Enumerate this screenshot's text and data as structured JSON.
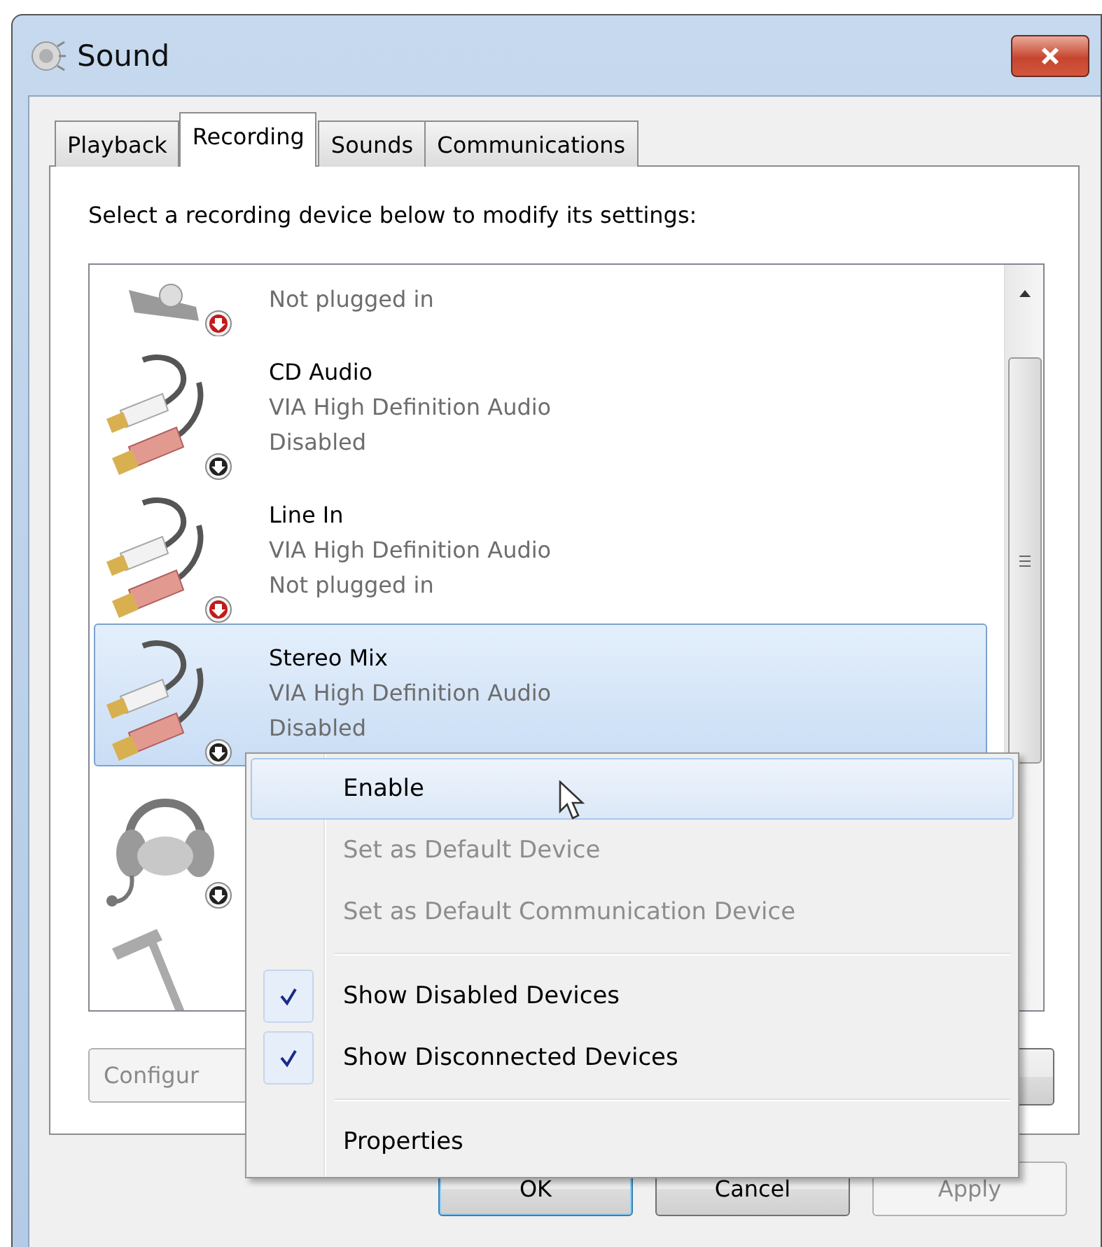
{
  "window": {
    "title": "Sound"
  },
  "tabs": [
    {
      "label": "Playback",
      "selected": false
    },
    {
      "label": "Recording",
      "selected": true
    },
    {
      "label": "Sounds",
      "selected": false
    },
    {
      "label": "Communications",
      "selected": false
    }
  ],
  "instruction": "Select a recording device below to modify its settings:",
  "devices": [
    {
      "kind": "mic-jack",
      "status": "Not plugged in",
      "color": "#c41a1a",
      "selected": false
    },
    {
      "kind": "rca",
      "name": "CD Audio",
      "driver": "VIA High Definition Audio",
      "status": "Disabled",
      "color": "#222222",
      "selected": false
    },
    {
      "kind": "rca",
      "name": "Line In",
      "driver": "VIA High Definition Audio",
      "status": "Not plugged in",
      "color": "#c41a1a",
      "selected": false
    },
    {
      "kind": "rca",
      "name": "Stereo Mix",
      "driver": "VIA High Definition Audio",
      "status": "Disabled",
      "color": "#222222",
      "selected": true
    },
    {
      "kind": "headset",
      "color": "#222222",
      "selected": false
    },
    {
      "kind": "microphone",
      "selected": false
    }
  ],
  "panel_buttons": [
    {
      "label": "Configur",
      "disabled": true
    }
  ],
  "context_menu": {
    "items": [
      {
        "kind": "command",
        "label": "Enable",
        "highlighted": true,
        "disabled": false,
        "checked": false
      },
      {
        "kind": "command",
        "label": "Set as Default Device",
        "highlighted": false,
        "disabled": true,
        "checked": false
      },
      {
        "kind": "command",
        "label": "Set as Default Communication Device",
        "highlighted": false,
        "disabled": true,
        "checked": false
      },
      {
        "kind": "separator"
      },
      {
        "kind": "command",
        "label": "Show Disabled Devices",
        "highlighted": false,
        "disabled": false,
        "checked": true
      },
      {
        "kind": "command",
        "label": "Show Disconnected Devices",
        "highlighted": false,
        "disabled": false,
        "checked": true
      },
      {
        "kind": "separator"
      },
      {
        "kind": "command",
        "label": "Properties",
        "highlighted": false,
        "disabled": false,
        "checked": false
      }
    ]
  },
  "buttons": [
    {
      "label": "OK",
      "default": true,
      "disabled": false
    },
    {
      "label": "Cancel",
      "default": false,
      "disabled": false
    },
    {
      "label": "Apply",
      "default": false,
      "disabled": true
    }
  ]
}
